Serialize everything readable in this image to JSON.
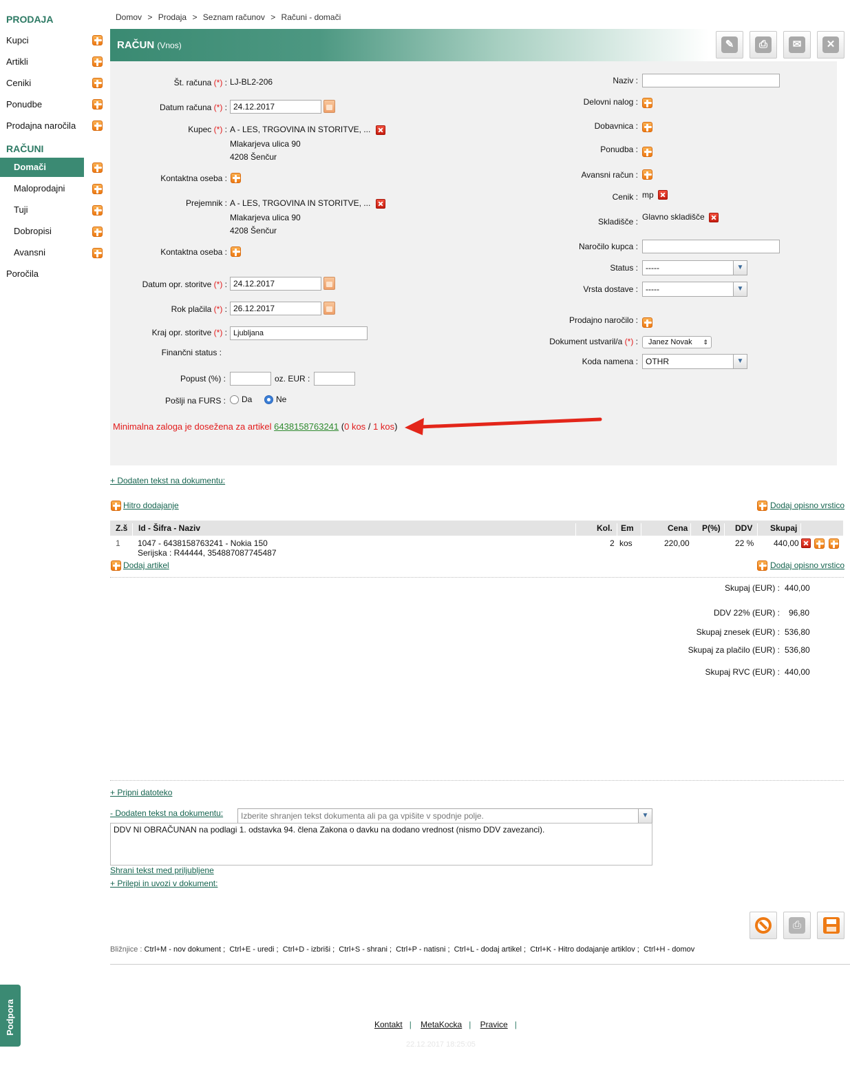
{
  "sidebar": {
    "section_sales": "PRODAJA",
    "items_sales": [
      "Kupci",
      "Artikli",
      "Ceniki",
      "Ponudbe",
      "Prodajna naročila"
    ],
    "section_invoices": "RAČUNI",
    "items_invoices": [
      "Domači",
      "Maloprodajni",
      "Tuji",
      "Dobropisi",
      "Avansni"
    ],
    "reports": "Poročila",
    "support": "Podpora"
  },
  "breadcrumb": [
    "Domov",
    "Prodaja",
    "Seznam računov",
    "Računi - domači"
  ],
  "breadcrumb_sep": ">",
  "title": {
    "main": "RAČUN",
    "mode": "(Vnos)"
  },
  "req": "(*)",
  "left_form": {
    "invoice_no_label": "Št. računa",
    "invoice_no": "LJ-BL2-206",
    "invoice_date_label": "Datum računa",
    "invoice_date": "24.12.2017",
    "buyer_label": "Kupec",
    "buyer_name": "A - LES, TRGOVINA IN STORITVE, ...",
    "buyer_street": "Mlakarjeva ulica 90",
    "buyer_city": "4208 Šenčur",
    "contact_label": "Kontaktna oseba :",
    "recipient_label": "Prejemnik :",
    "recipient_name": "A - LES, TRGOVINA IN STORITVE, ...",
    "recipient_street": "Mlakarjeva ulica 90",
    "recipient_city": "4208 Šenčur",
    "contact2_label": "Kontaktna oseba :",
    "service_date_label": "Datum opr. storitve",
    "service_date": "24.12.2017",
    "due_label": "Rok plačila",
    "due_date": "26.12.2017",
    "place_label": "Kraj opr. storitve",
    "place": "Ljubljana",
    "fin_status_label": "Finančni status :",
    "discount_label": "Popust (%) :",
    "discount_eur_label": "oz. EUR :",
    "furs_label": "Pošlji na FURS :",
    "furs_yes": "Da",
    "furs_no": "Ne"
  },
  "right_form": {
    "name_label": "Naziv :",
    "work_order_label": "Delovni nalog :",
    "delivery_note_label": "Dobavnica :",
    "offer_label": "Ponudba :",
    "advance_label": "Avansni račun :",
    "pricelist_label": "Cenik :",
    "pricelist": "mp",
    "warehouse_label": "Skladišče :",
    "warehouse": "Glavno skladišče",
    "customer_order_label": "Naročilo kupca :",
    "status_label": "Status :",
    "status_value": "-----",
    "delivery_type_label": "Vrsta dostave :",
    "delivery_type_value": "-----",
    "sales_order_label": "Prodajno naročilo :",
    "created_by_label": "Dokument ustvaril/a",
    "created_by": "Janez Novak",
    "purpose_label": "Koda namena :",
    "purpose": "OTHR"
  },
  "warning": {
    "text": "Minimalna zaloga je dosežena za artikel",
    "article": "6438158763241",
    "paren_open": "(",
    "qty": "0 kos",
    "slash": "/",
    "min": "1 kos",
    "paren_close": ")"
  },
  "links": {
    "added_text_top": "+ Dodaten tekst na dokumentu:",
    "quick_add": "Hitro dodajanje",
    "add_desc_row": "Dodaj opisno vrstico",
    "add_article": "Dodaj artikel",
    "attach_file": "+ Pripni datoteko",
    "added_text": "- Dodaten tekst na dokumentu:",
    "save_fav": "Shrani tekst med priljubljene",
    "paste_import": "+ Prilepi in uvozi v dokument:"
  },
  "table": {
    "headers": [
      "Z.š",
      "Id - Šifra - Naziv",
      "Kol.",
      "Em",
      "Cena",
      "P(%)",
      "DDV",
      "Skupaj"
    ],
    "rows": [
      {
        "no": "1",
        "name": "1047 - 6438158763241 - Nokia 150",
        "serial": "Serijska : R44444, 354887087745487",
        "qty": "2",
        "unit": "kos",
        "price": "220,00",
        "disc": "",
        "vat": "22 %",
        "total": "440,00"
      }
    ]
  },
  "totals": [
    {
      "label": "Skupaj (EUR) :",
      "value": "440,00"
    },
    {
      "label": "DDV 22% (EUR) :",
      "value": "96,80"
    },
    {
      "label": "Skupaj znesek (EUR) :",
      "value": "536,80"
    },
    {
      "label": "Skupaj za plačilo (EUR) :",
      "value": "536,80"
    },
    {
      "label": "Skupaj RVC (EUR) :",
      "value": "440,00"
    }
  ],
  "doc_text": {
    "placeholder": "Izberite shranjen tekst dokumenta ali pa ga vpišite v spodnje polje.",
    "content": "DDV NI OBRAČUNAN na podlagi 1. odstavka 94. člena Zakona o davku na dodano vrednost (nismo DDV zavezanci)."
  },
  "shortcuts": {
    "label": "Bližnjice :",
    "items": [
      "Ctrl+M - nov dokument ;",
      "Ctrl+E - uredi ;",
      "Ctrl+D - izbriši ;",
      "Ctrl+S - shrani ;",
      "Ctrl+P - natisni ;",
      "Ctrl+L - dodaj artikel ;",
      "Ctrl+K - Hitro dodajanje artiklov ;",
      "Ctrl+H - domov"
    ]
  },
  "footer": {
    "links": [
      "Kontakt",
      "MetaKocka",
      "Pravice"
    ],
    "sep": "|",
    "timestamp": "22.12.2017 18:25:05"
  },
  "colors": {
    "brand": "#3b8a73",
    "required": "#e21b1b",
    "link": "#15644f"
  }
}
